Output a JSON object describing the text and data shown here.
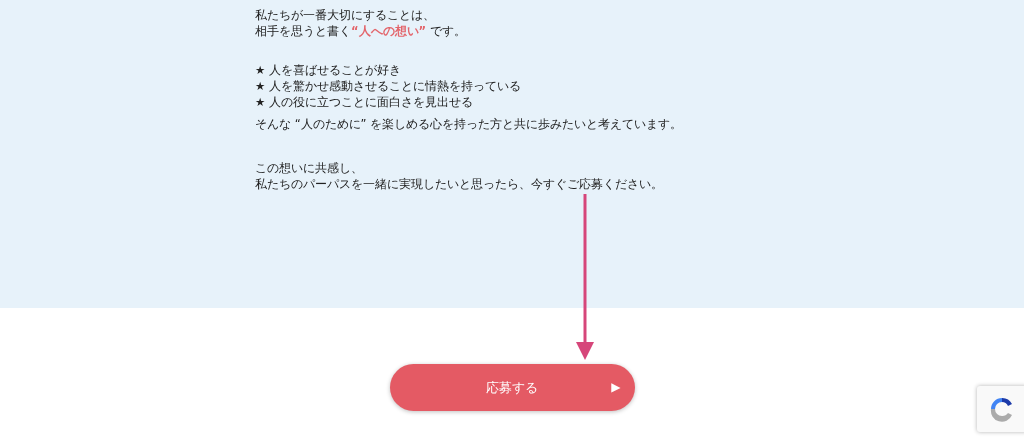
{
  "message": {
    "blocks": [
      {
        "kind": "paragraph",
        "lines": [
          [
            {
              "text": "私たちが一番大切にすることは、",
              "highlight": false
            }
          ],
          [
            {
              "text": "相手を思うと書く",
              "highlight": false
            },
            {
              "text": "“人への想い”",
              "highlight": true
            },
            {
              "text": " です。",
              "highlight": false
            }
          ]
        ]
      },
      {
        "kind": "list",
        "lines": [
          [
            {
              "text": "★ 人を喜ばせることが好き",
              "highlight": false
            }
          ],
          [
            {
              "text": "★ 人を驚かせ感動させることに情熱を持っている",
              "highlight": false
            }
          ],
          [
            {
              "text": "★ 人の役に立つことに面白さを見出せる",
              "highlight": false
            }
          ]
        ]
      },
      {
        "kind": "sentence",
        "lines": [
          [
            {
              "text": "そんな “人のために” を楽しめる心を持った方と共に歩みたいと考えています。",
              "highlight": false
            }
          ]
        ]
      },
      {
        "kind": "paragraph",
        "lines": [
          [
            {
              "text": "この想いに共感し、",
              "highlight": false
            }
          ],
          [
            {
              "text": "私たちのパーパスを一緒に実現したいと思ったら、今すぐご応募ください。",
              "highlight": false
            }
          ]
        ]
      }
    ]
  },
  "apply_button": {
    "label": "応募する",
    "arrow": "▶"
  }
}
